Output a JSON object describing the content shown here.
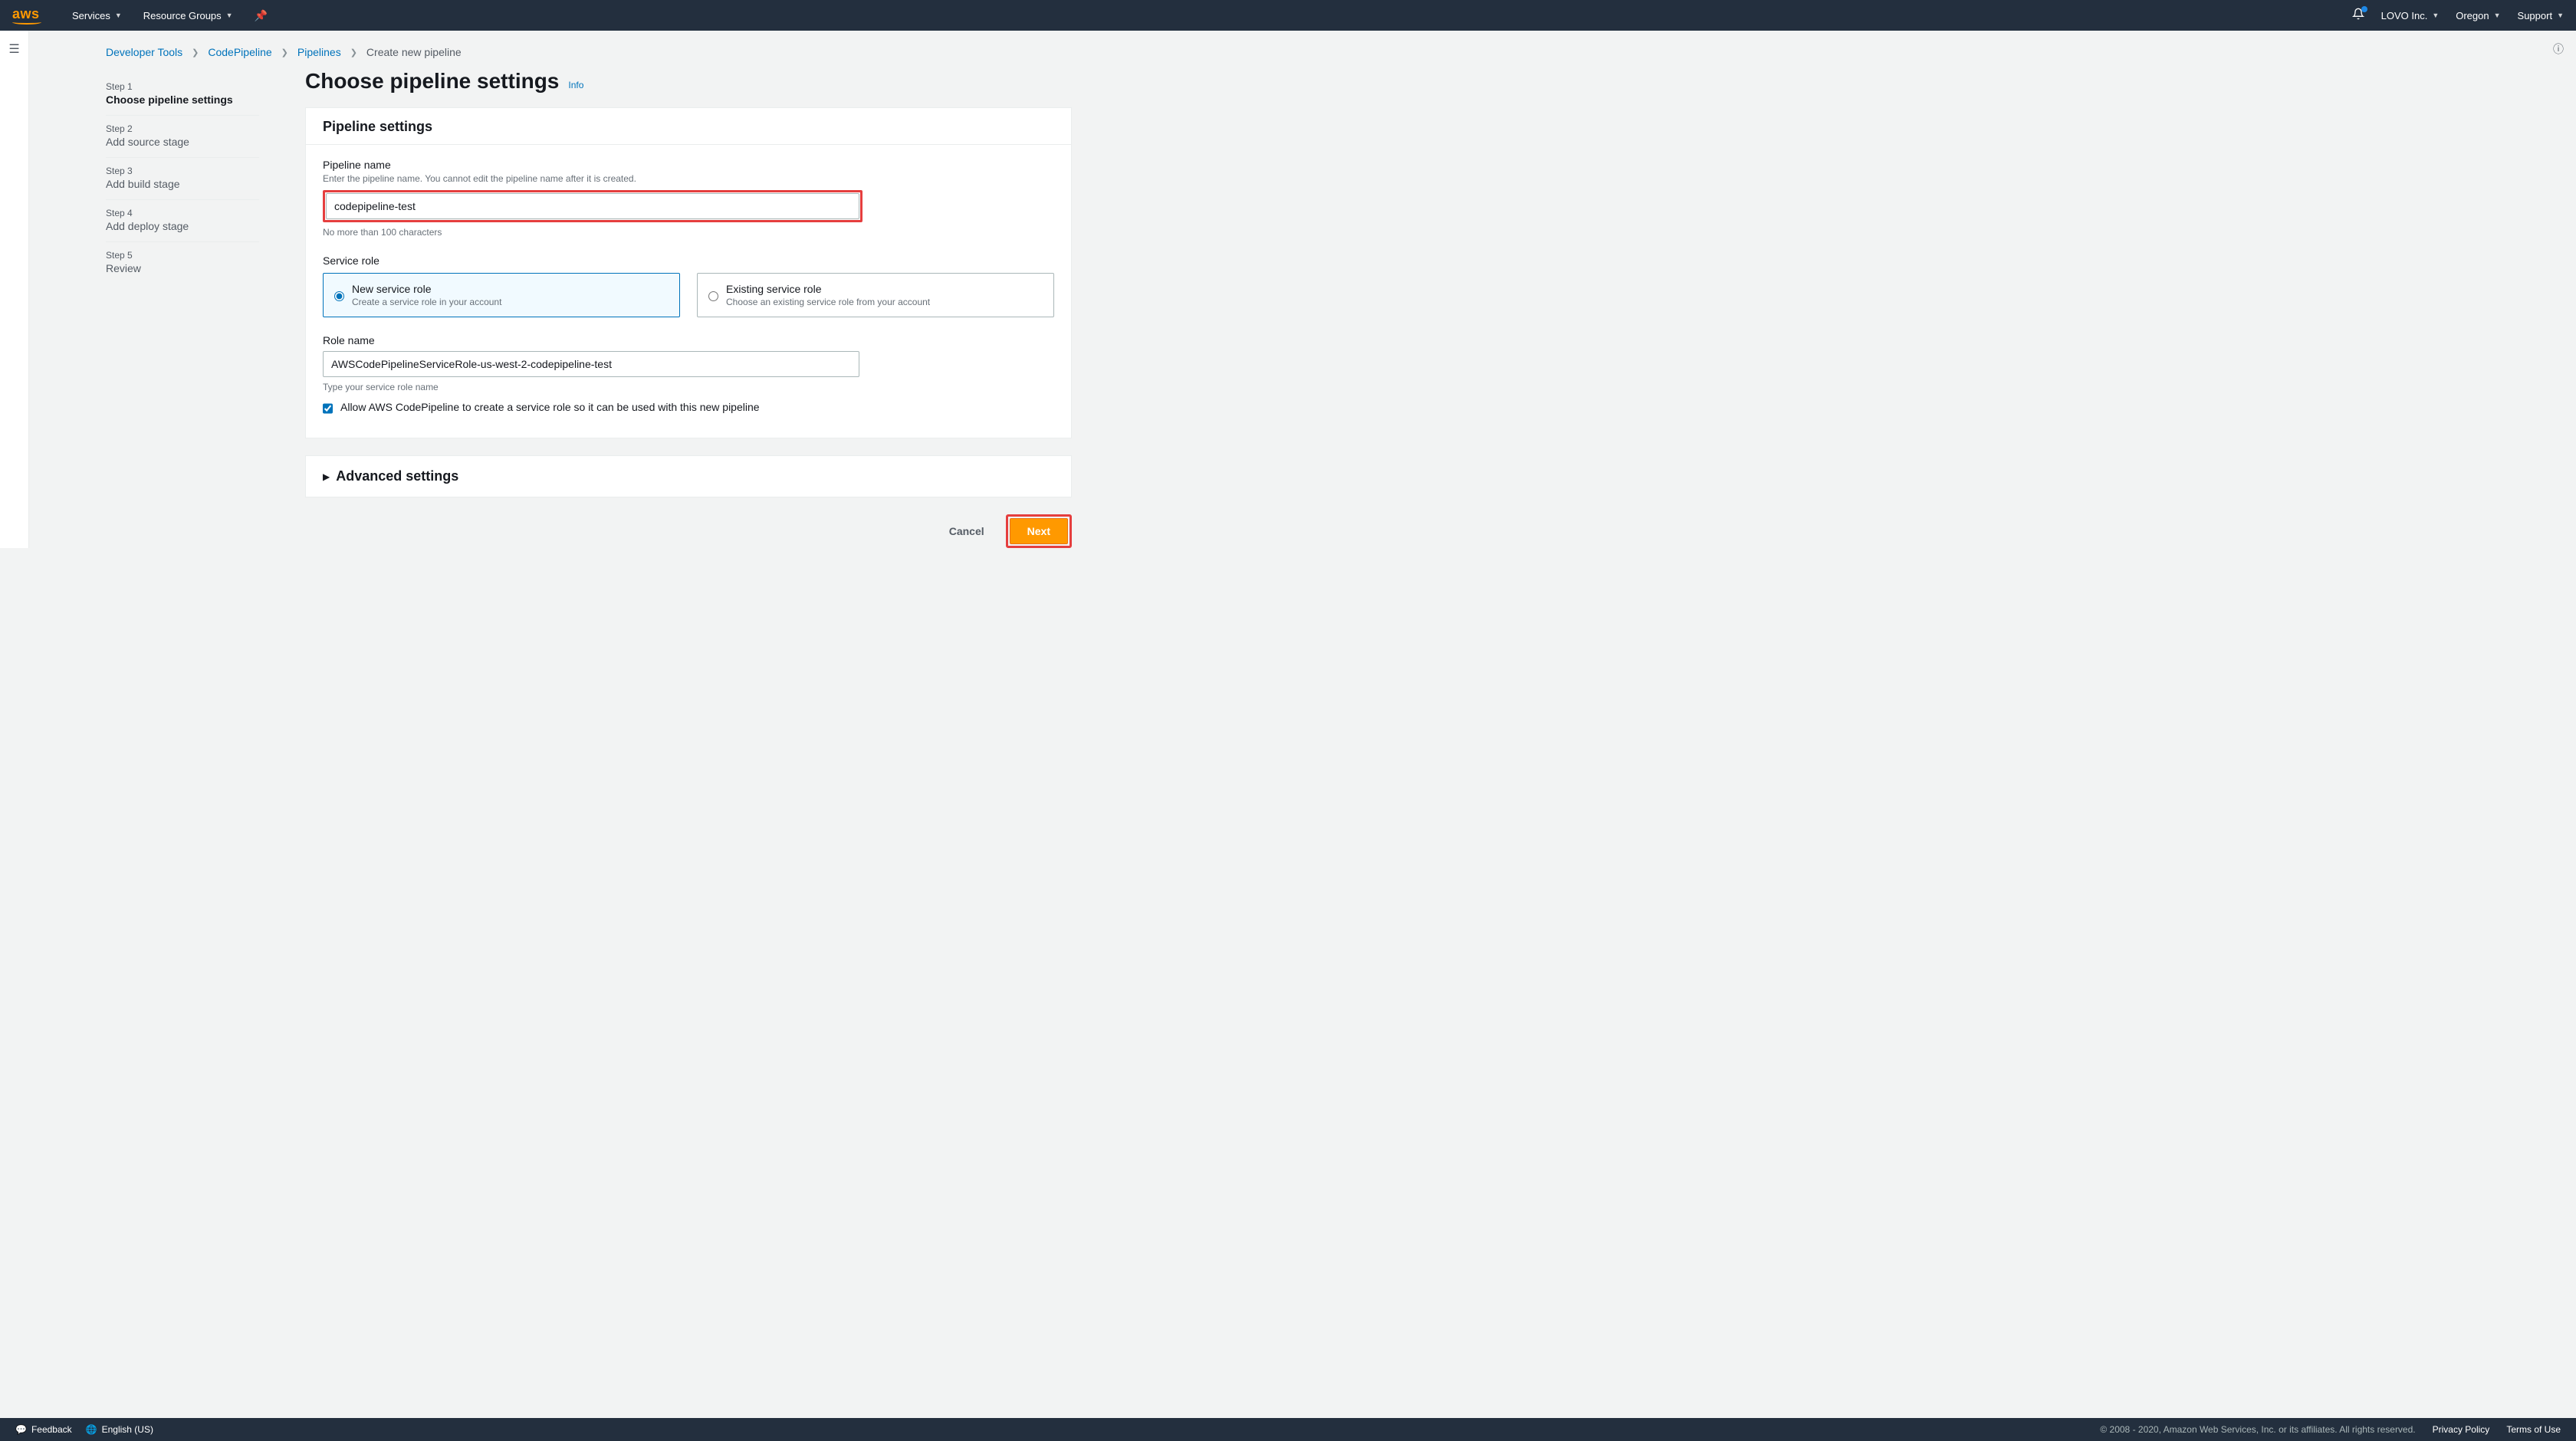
{
  "topbar": {
    "services": "Services",
    "resource_groups": "Resource Groups",
    "account": "LOVO Inc.",
    "region": "Oregon",
    "support": "Support"
  },
  "breadcrumb": {
    "dev_tools": "Developer Tools",
    "codepipeline": "CodePipeline",
    "pipelines": "Pipelines",
    "current": "Create new pipeline"
  },
  "steps": [
    {
      "num": "Step 1",
      "label": "Choose pipeline settings"
    },
    {
      "num": "Step 2",
      "label": "Add source stage"
    },
    {
      "num": "Step 3",
      "label": "Add build stage"
    },
    {
      "num": "Step 4",
      "label": "Add deploy stage"
    },
    {
      "num": "Step 5",
      "label": "Review"
    }
  ],
  "heading": {
    "title": "Choose pipeline settings",
    "info": "Info"
  },
  "panel1": {
    "title": "Pipeline settings",
    "name_label": "Pipeline name",
    "name_hint": "Enter the pipeline name. You cannot edit the pipeline name after it is created.",
    "name_value": "codepipeline-test",
    "name_below": "No more than 100 characters",
    "service_role_label": "Service role",
    "tile_new_title": "New service role",
    "tile_new_desc": "Create a service role in your account",
    "tile_existing_title": "Existing service role",
    "tile_existing_desc": "Choose an existing service role from your account",
    "role_name_label": "Role name",
    "role_name_value": "AWSCodePipelineServiceRole-us-west-2-codepipeline-test",
    "role_name_below": "Type your service role name",
    "allow_checkbox": "Allow AWS CodePipeline to create a service role so it can be used with this new pipeline"
  },
  "panel2": {
    "title": "Advanced settings"
  },
  "actions": {
    "cancel": "Cancel",
    "next": "Next"
  },
  "footer": {
    "feedback": "Feedback",
    "language": "English (US)",
    "copy": "© 2008 - 2020, Amazon Web Services, Inc. or its affiliates. All rights reserved.",
    "privacy": "Privacy Policy",
    "terms": "Terms of Use"
  }
}
